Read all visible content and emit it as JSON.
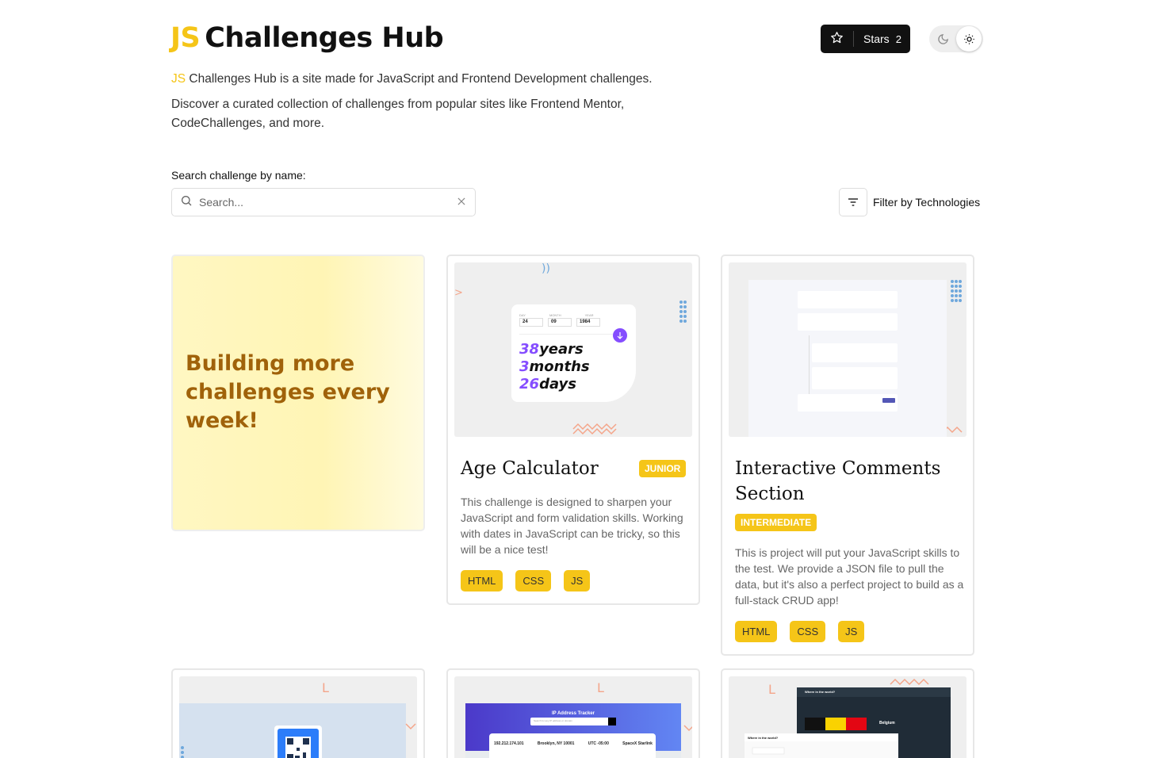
{
  "header": {
    "logo_accent": "JS",
    "logo_rest": "Challenges Hub",
    "stars_label": "Stars",
    "stars_count": "2"
  },
  "intro": {
    "accent": "JS",
    "line1_rest": " Challenges Hub is a site made for JavaScript and Frontend Development challenges.",
    "line2": "Discover a curated collection of challenges from popular sites like Frontend Mentor, CodeChallenges, and more."
  },
  "search": {
    "label": "Search challenge by name:",
    "placeholder": "Search...",
    "value": ""
  },
  "filter": {
    "label": "Filter by Technologies"
  },
  "promo": {
    "text": "Building more challenges every week!"
  },
  "cards": [
    {
      "title": "Age Calculator",
      "level": "JUNIOR",
      "description": "This challenge is designed to sharpen your JavaScript and form validation skills. Working with dates in JavaScript can be tricky, so this will be a nice test!",
      "tags": [
        "HTML",
        "CSS",
        "JS"
      ],
      "preview": {
        "fields": [
          "DAY",
          "MONTH",
          "YEAR"
        ],
        "values": [
          "24",
          "09",
          "1984"
        ],
        "results": [
          {
            "n": "38",
            "unit": "years"
          },
          {
            "n": "3",
            "unit": "months"
          },
          {
            "n": "26",
            "unit": "days"
          }
        ]
      }
    },
    {
      "title": "Interactive Comments Section",
      "level": "INTERMEDIATE",
      "description": "This is project will put your JavaScript skills to the test. We provide a JSON file to pull the data, but it's also a perfect project to build as a full-stack CRUD app!",
      "tags": [
        "HTML",
        "CSS",
        "JS"
      ]
    }
  ],
  "previews_row2": {
    "ip_title": "IP Address Tracker",
    "ip_placeholder": "Search for any IP address or domain",
    "ip_values": [
      "192.212.174.101",
      "Brooklyn, NY 10001",
      "UTC -05:00",
      "SpaceX Starlink"
    ],
    "countries_title": "Where in the world?",
    "countries_country": "Belgium"
  },
  "colors": {
    "accent": "#f5c518",
    "promo_text": "#a0620a",
    "age_purple": "#854dff"
  }
}
